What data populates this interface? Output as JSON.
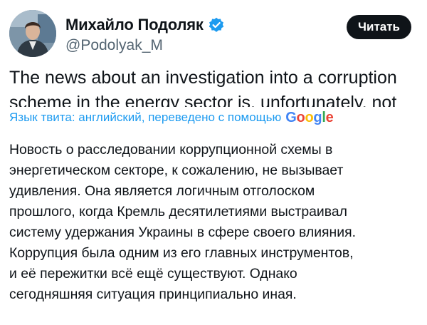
{
  "author": {
    "name": "Михайло Подоляк",
    "handle": "@Podolyak_M",
    "verified": true
  },
  "read_button": {
    "label": "Читать"
  },
  "original_text": "The news about an investigation into a corruption scheme in the energy sector is, unfortunately, not",
  "translation": {
    "label": "Язык твита: английский, переведено с помощью",
    "provider": "Google"
  },
  "translated_lines": [
    "Новость о расследовании коррупционной схемы в",
    "энергетическом секторе, к сожалению, не вызывает",
    "удивления. Она является логичным отголоском",
    "прошлого, когда Кремль десятилетиями выстраивал",
    "систему удержания Украины в сфере своего влияния.",
    "Коррупция была одним из его главных инструментов,",
    "и её пережитки всё ещё существуют. Однако",
    "сегодняшняя ситуация принципиально иная."
  ],
  "colors": {
    "accent": "#1d9bf0",
    "text": "#0f1419",
    "muted": "#536471"
  },
  "icons": [
    "verified-badge-icon",
    "google-logo"
  ]
}
